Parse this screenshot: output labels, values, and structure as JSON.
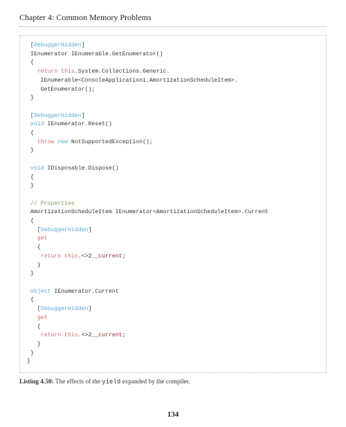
{
  "chapter_title": "Chapter 4: Common Memory Problems",
  "code_lines": [
    {
      "segs": [
        {
          "t": " ["
        },
        {
          "t": "DebuggerHidden",
          "c": "kw-type"
        },
        {
          "t": "]"
        }
      ]
    },
    {
      "segs": [
        {
          "t": " IEnumerator IEnumerable.GetEnumerator()"
        }
      ]
    },
    {
      "segs": [
        {
          "t": " {"
        }
      ]
    },
    {
      "segs": [
        {
          "t": "   "
        },
        {
          "t": "return this",
          "c": "kw-flow"
        },
        {
          "t": ".System.Collections.Generic."
        }
      ]
    },
    {
      "segs": [
        {
          "t": "    IEnumerable<ConsoleApplication1.AmortizationScheduleItem>."
        }
      ]
    },
    {
      "segs": [
        {
          "t": "    GetEnumerator();"
        }
      ]
    },
    {
      "segs": [
        {
          "t": " }"
        }
      ]
    },
    {
      "segs": [
        {
          "t": " "
        }
      ]
    },
    {
      "segs": [
        {
          "t": " ["
        },
        {
          "t": "DebuggerHidden",
          "c": "kw-type"
        },
        {
          "t": "]"
        }
      ]
    },
    {
      "segs": [
        {
          "t": " "
        },
        {
          "t": "void",
          "c": "kw-type"
        },
        {
          "t": " IEnumerator.Reset()"
        }
      ]
    },
    {
      "segs": [
        {
          "t": " {"
        }
      ]
    },
    {
      "segs": [
        {
          "t": "   "
        },
        {
          "t": "throw",
          "c": "kw-flow"
        },
        {
          "t": " "
        },
        {
          "t": "new",
          "c": "kw-type"
        },
        {
          "t": " NotSupportedException();"
        }
      ]
    },
    {
      "segs": [
        {
          "t": " }"
        }
      ]
    },
    {
      "segs": [
        {
          "t": " "
        }
      ]
    },
    {
      "segs": [
        {
          "t": " "
        },
        {
          "t": "void",
          "c": "kw-type"
        },
        {
          "t": " IDisposable.Dispose()"
        }
      ]
    },
    {
      "segs": [
        {
          "t": " {"
        }
      ]
    },
    {
      "segs": [
        {
          "t": " }"
        }
      ]
    },
    {
      "segs": [
        {
          "t": " "
        }
      ]
    },
    {
      "segs": [
        {
          "t": " "
        },
        {
          "t": "// Properties",
          "c": "comment"
        }
      ]
    },
    {
      "segs": [
        {
          "t": " AmortizationScheduleItem IEnumerator<AmortizationScheduleItem>.Current"
        }
      ]
    },
    {
      "segs": [
        {
          "t": " {"
        }
      ]
    },
    {
      "segs": [
        {
          "t": "   ["
        },
        {
          "t": "DebuggerHidden",
          "c": "kw-type"
        },
        {
          "t": "]"
        }
      ]
    },
    {
      "segs": [
        {
          "t": "   "
        },
        {
          "t": "get",
          "c": "kw-flow"
        }
      ]
    },
    {
      "segs": [
        {
          "t": "   {"
        }
      ]
    },
    {
      "segs": [
        {
          "t": "    "
        },
        {
          "t": "return this",
          "c": "kw-flow"
        },
        {
          "t": ".<>2"
        },
        {
          "t": "__current",
          "c": "kw-str"
        },
        {
          "t": ";"
        }
      ]
    },
    {
      "segs": [
        {
          "t": "   }"
        }
      ]
    },
    {
      "segs": [
        {
          "t": " }"
        }
      ]
    },
    {
      "segs": [
        {
          "t": " "
        }
      ]
    },
    {
      "segs": [
        {
          "t": " "
        },
        {
          "t": "object",
          "c": "kw-type"
        },
        {
          "t": " IEnumerator.Current"
        }
      ]
    },
    {
      "segs": [
        {
          "t": " {"
        }
      ]
    },
    {
      "segs": [
        {
          "t": "   ["
        },
        {
          "t": "DebuggerHidden",
          "c": "kw-type"
        },
        {
          "t": "]"
        }
      ]
    },
    {
      "segs": [
        {
          "t": "   "
        },
        {
          "t": "get",
          "c": "kw-flow"
        }
      ]
    },
    {
      "segs": [
        {
          "t": "   {"
        }
      ]
    },
    {
      "segs": [
        {
          "t": "    "
        },
        {
          "t": "return this",
          "c": "kw-flow"
        },
        {
          "t": ".<>2"
        },
        {
          "t": "__current",
          "c": "kw-str"
        },
        {
          "t": ";"
        }
      ]
    },
    {
      "segs": [
        {
          "t": "   }"
        }
      ]
    },
    {
      "segs": [
        {
          "t": " }"
        }
      ]
    },
    {
      "segs": [
        {
          "t": "}"
        }
      ]
    }
  ],
  "listing": {
    "label": "Listing 4.50:",
    "before_mono": "  The effects of the ",
    "mono": "yield",
    "after_mono": " expanded by the compiler."
  },
  "page_number": "134"
}
